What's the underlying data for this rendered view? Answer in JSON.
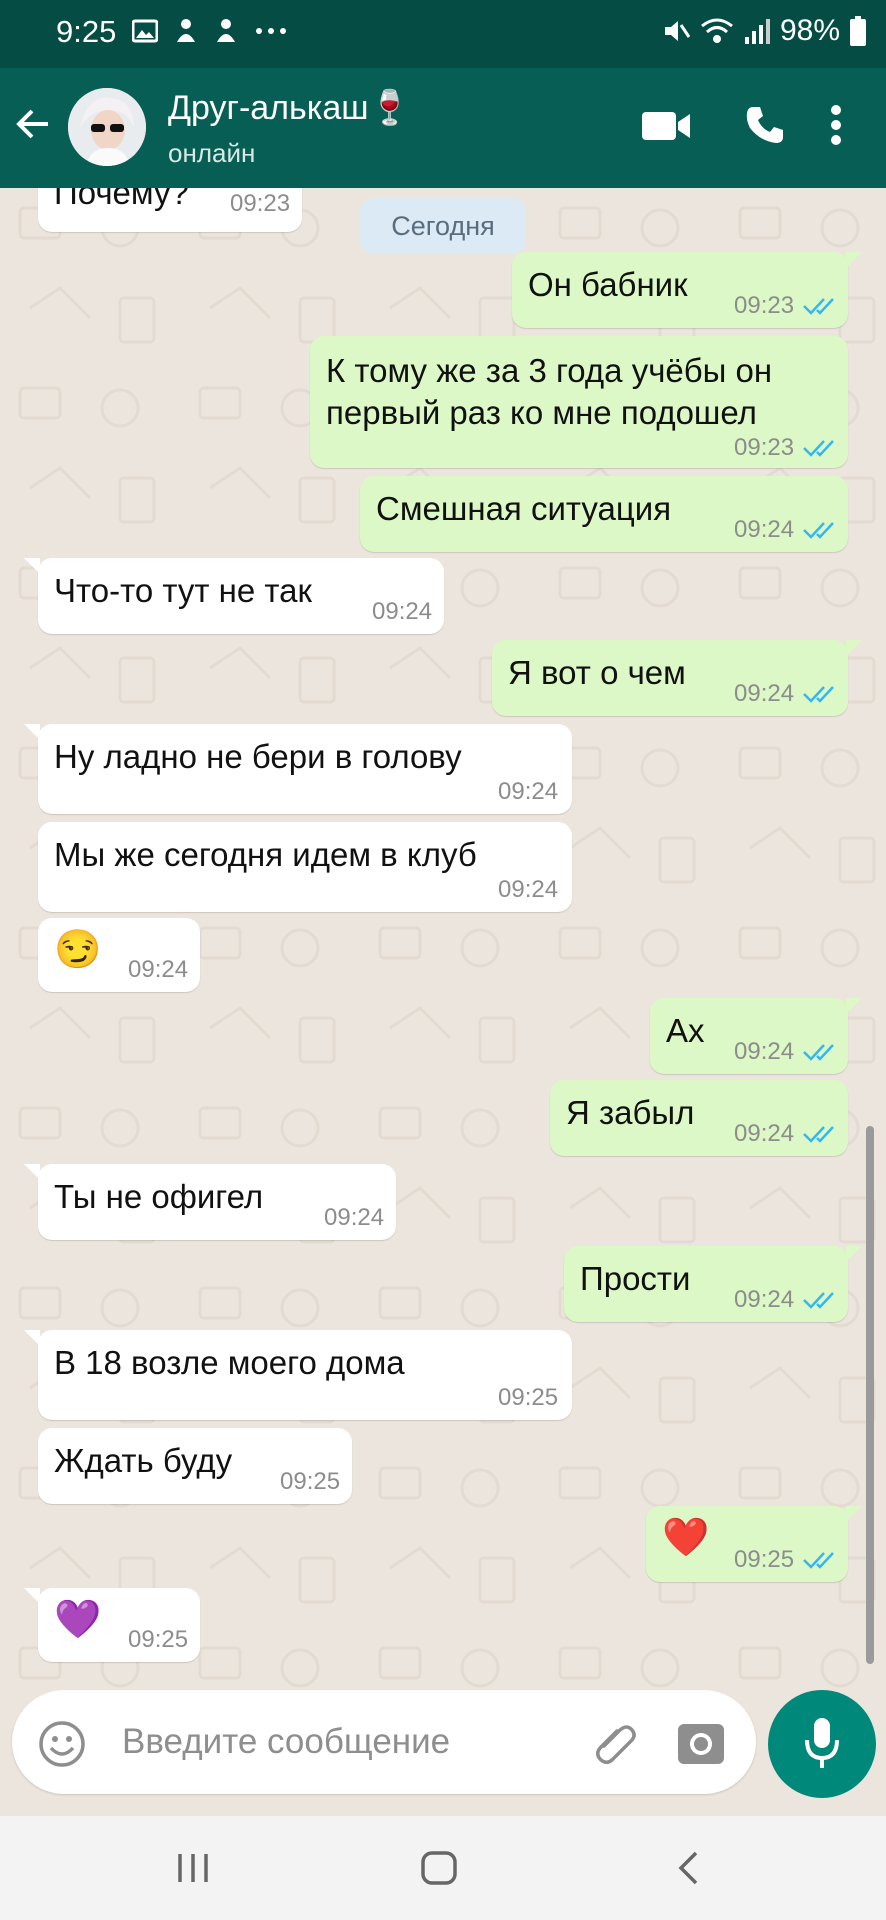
{
  "status_bar": {
    "time": "9:25",
    "battery": "98%"
  },
  "header": {
    "contact_name": "Друг-алькаш",
    "contact_emoji": "🍷",
    "contact_status": "онлайн"
  },
  "chat": {
    "date_chip": "Сегодня",
    "messages": [
      {
        "dir": "in",
        "text": "Почему?",
        "time": "09:23"
      },
      {
        "dir": "out",
        "text": "Он бабник",
        "time": "09:23",
        "read": true
      },
      {
        "dir": "out",
        "text": "К тому же за 3 года учёбы он",
        "text2": "первый раз ко мне подошел",
        "time": "09:23",
        "read": true
      },
      {
        "dir": "out",
        "text": "Смешная ситуация",
        "time": "09:24",
        "read": true
      },
      {
        "dir": "in",
        "text": "Что-то тут не так",
        "time": "09:24"
      },
      {
        "dir": "out",
        "text": "Я вот о чем",
        "time": "09:24",
        "read": true
      },
      {
        "dir": "in",
        "text": "Ну ладно не бери в голову",
        "time": "09:24"
      },
      {
        "dir": "in",
        "text": "Мы же сегодня идем в клуб",
        "time": "09:24"
      },
      {
        "dir": "in",
        "text": "😏",
        "time": "09:24"
      },
      {
        "dir": "out",
        "text": "Ах",
        "time": "09:24",
        "read": true
      },
      {
        "dir": "out",
        "text": "Я забыл",
        "time": "09:24",
        "read": true
      },
      {
        "dir": "in",
        "text": "Ты не офигел",
        "time": "09:24"
      },
      {
        "dir": "out",
        "text": "Прости",
        "time": "09:24",
        "read": true
      },
      {
        "dir": "in",
        "text": "В 18 возле моего дома",
        "time": "09:25"
      },
      {
        "dir": "in",
        "text": "Ждать буду",
        "time": "09:25"
      },
      {
        "dir": "out",
        "text": "❤️",
        "time": "09:25",
        "read": true
      },
      {
        "dir": "in",
        "text": "💜",
        "time": "09:25"
      }
    ]
  },
  "composer": {
    "placeholder": "Введите сообщение"
  },
  "colors": {
    "header": "#075e54",
    "status_bar": "#054d44",
    "outgoing": "#dcf8c6",
    "incoming": "#ffffff",
    "read_ticks": "#34b7f1",
    "mic_button": "#00897b"
  },
  "icons": [
    "picture-icon",
    "notification-icon",
    "more-dots-icon",
    "mute-icon",
    "wifi-icon",
    "signal-icon",
    "battery-icon",
    "back-arrow-icon",
    "video-call-icon",
    "phone-call-icon",
    "menu-dots-icon",
    "emoji-icon",
    "attach-icon",
    "camera-icon",
    "mic-icon",
    "recent-apps-icon",
    "home-icon",
    "back-nav-icon"
  ]
}
